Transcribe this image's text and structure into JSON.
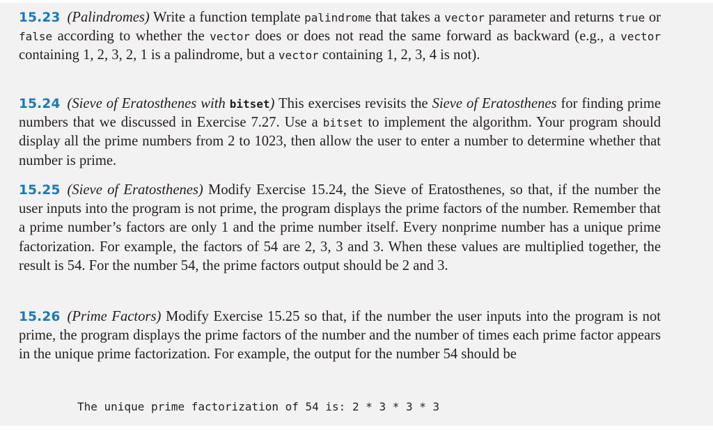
{
  "exercises": [
    {
      "number": "15.23",
      "title": "(Palindromes)",
      "segments": [
        {
          "t": " Write a function template "
        },
        {
          "c": "palindrome"
        },
        {
          "t": " that takes a "
        },
        {
          "c": "vector"
        },
        {
          "t": " parameter and returns "
        },
        {
          "c": "true"
        },
        {
          "t": " or "
        },
        {
          "c": "false"
        },
        {
          "t": " according to whether the "
        },
        {
          "c": "vector"
        },
        {
          "t": " does or does not read the same forward as backward (e.g., a "
        },
        {
          "c": "vector"
        },
        {
          "t": " containing 1, 2, 3, 2, 1 is a palindrome, but a "
        },
        {
          "c": "vector"
        },
        {
          "t": " containing 1, 2, 3, 4 is not)."
        }
      ]
    },
    {
      "number": "15.24",
      "title_parts": [
        {
          "t": "(Sieve of Eratosthenes with "
        },
        {
          "cb": "bitset"
        },
        {
          "t": ")"
        }
      ],
      "segments": [
        {
          "t": " This exercises revisits the "
        },
        {
          "i": "Sieve of Eratosthenes"
        },
        {
          "t": " for finding prime numbers that we discussed in Exercise 7.27. Use a "
        },
        {
          "c": "bitset"
        },
        {
          "t": " to implement the algorithm. Your program should display all the prime numbers from 2 to 1023, then allow the user to enter a number to determine whether that number is prime."
        }
      ]
    },
    {
      "number": "15.25",
      "title": "(Sieve of Eratosthenes)",
      "segments": [
        {
          "t": " Modify Exercise 15.24, the Sieve of Eratosthenes, so that, if the number the user inputs into the program is not prime, the program displays the prime factors of the number. Remember that a prime number’s factors are only 1 and the prime number itself. Every nonprime number has a unique prime factorization. For example, the factors of 54 are 2, 3, 3 and 3. When these values are multiplied together, the result is 54. For the number 54, the prime factors output should be 2 and 3."
        }
      ]
    },
    {
      "number": "15.26",
      "title": "(Prime Factors)",
      "segments": [
        {
          "t": " Modify Exercise 15.25 so that, if the number the user inputs into the program is not prime, the program displays the prime factors of the number and the number of times each prime factor appears in the unique prime factorization. For example, the output for the number 54 should be"
        }
      ]
    }
  ],
  "sample_output": "The unique prime factorization of 54 is: 2 * 3 * 3 * 3",
  "colors": {
    "exercise_number": "#1a7ab8",
    "page_background": "#f2f2f2",
    "text": "#231f20"
  }
}
